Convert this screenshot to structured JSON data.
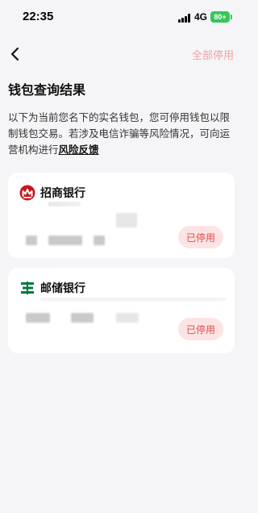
{
  "status": {
    "time": "22:35",
    "network": "4G",
    "battery": "80+",
    "battery_color": "#34c759"
  },
  "nav": {
    "back_icon": "chevron-left-icon",
    "stop_all_label": "全部停用"
  },
  "page": {
    "title": "钱包查询结果",
    "description": "以下为当前您名下的实名钱包，您可停用钱包以限制钱包交易。若涉及电信诈骗等风险情况，可向运营机构进行",
    "feedback_link": "风险反馈"
  },
  "wallets": [
    {
      "bank_name": "招商银行",
      "logo_icon": "cmb-logo-icon",
      "logo_color": "#c8161d",
      "stop_label": "已停用"
    },
    {
      "bank_name": "邮储银行",
      "logo_icon": "psbc-logo-icon",
      "logo_color": "#007a3d",
      "stop_label": "已停用"
    }
  ],
  "colors": {
    "accent_red": "#e04b4b",
    "stop_bg": "#fde4e4",
    "stop_all": "#f2a0a0"
  }
}
